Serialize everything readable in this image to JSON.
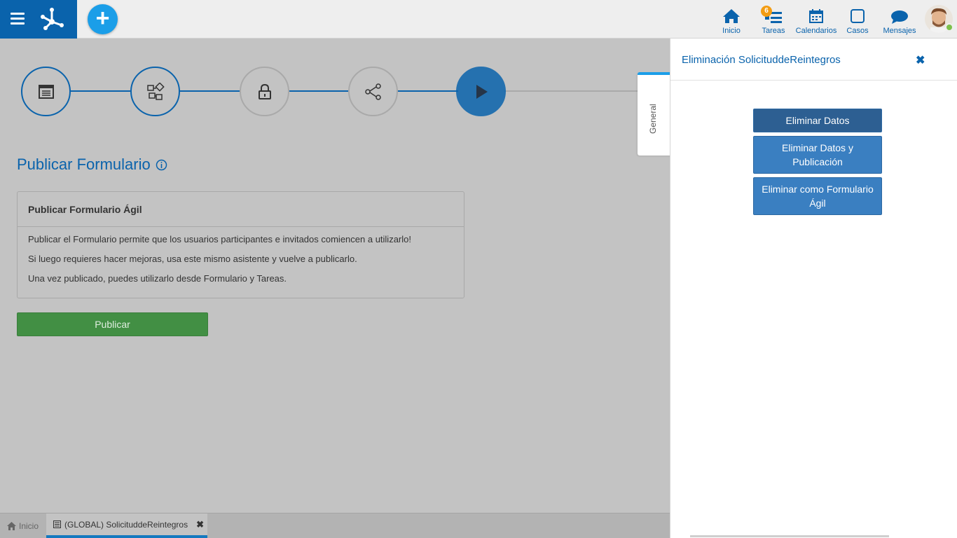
{
  "nav": {
    "items": [
      {
        "label": "Inicio",
        "icon": "home-icon"
      },
      {
        "label": "Tareas",
        "icon": "tasks-icon",
        "badge": "6"
      },
      {
        "label": "Calendarios",
        "icon": "calendar-icon"
      },
      {
        "label": "Casos",
        "icon": "cases-icon"
      },
      {
        "label": "Mensajes",
        "icon": "messages-icon"
      }
    ]
  },
  "wizard": {
    "steps": [
      {
        "icon": "form-icon",
        "state": "done"
      },
      {
        "icon": "workflow-icon",
        "state": "done"
      },
      {
        "icon": "lock-icon",
        "state": "todo"
      },
      {
        "icon": "share-icon",
        "state": "todo"
      },
      {
        "icon": "play-icon",
        "state": "active"
      }
    ]
  },
  "main": {
    "title": "Publicar Formulario",
    "card": {
      "heading": "Publicar Formulario Ágil",
      "lines": [
        "Publicar el Formulario permite que los usuarios participantes e invitados comiencen a utilizarlo!",
        "Si luego requieres hacer mejoras, usa este mismo asistente y vuelve a publicarlo.",
        "Una vez publicado, puedes utilizarlo desde Formulario y Tareas."
      ]
    },
    "publish_label": "Publicar"
  },
  "side_tab": {
    "label": "General"
  },
  "panel": {
    "title": "Eliminación SolicituddeReintegros",
    "buttons": [
      "Eliminar Datos",
      "Eliminar Datos y Publicación",
      "Eliminar como Formulario Ágil"
    ]
  },
  "bottom_tabs": {
    "home": "Inicio",
    "doc": "(GLOBAL) SolicituddeReintegros"
  },
  "colors": {
    "brand": "#0a63ac",
    "accent": "#1b9ee8",
    "publish": "#428f44"
  }
}
